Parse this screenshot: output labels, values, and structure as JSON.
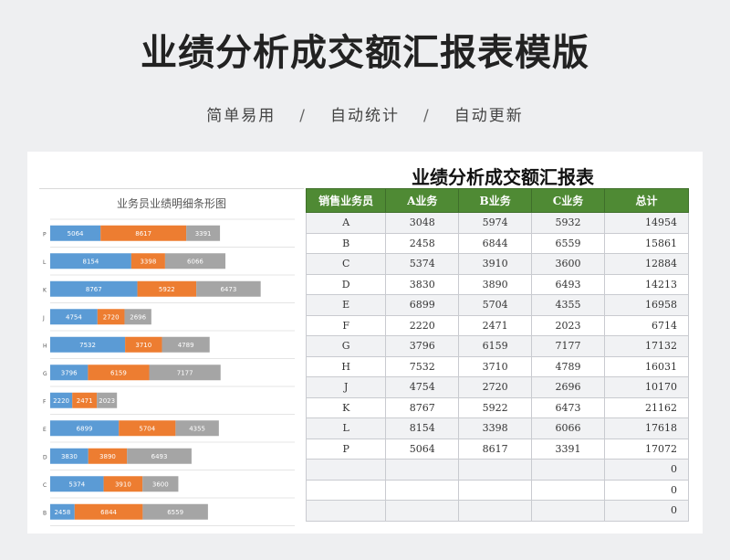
{
  "page": {
    "title": "业绩分析成交额汇报表模版",
    "tagline": [
      "简单易用",
      "自动统计",
      "自动更新"
    ],
    "separator": "/"
  },
  "sheet": {
    "title": "业绩分析成交额汇报表"
  },
  "chart_data": {
    "type": "bar",
    "orientation": "horizontal-stacked",
    "title": "业务员业绩明细条形图",
    "categories": [
      "P",
      "L",
      "K",
      "J",
      "H",
      "G",
      "F",
      "E",
      "D",
      "C",
      "B"
    ],
    "series": [
      {
        "name": "A业务",
        "color": "#5b9bd5",
        "values": [
          5064,
          8154,
          8767,
          4754,
          7532,
          3796,
          2220,
          6899,
          3830,
          5374,
          2458
        ]
      },
      {
        "name": "B业务",
        "color": "#ed7d31",
        "values": [
          8617,
          3398,
          5922,
          2720,
          3710,
          6159,
          2471,
          5704,
          3890,
          3910,
          6844
        ]
      },
      {
        "name": "C业务",
        "color": "#a5a5a5",
        "values": [
          3391,
          6066,
          6473,
          2696,
          4789,
          7177,
          2023,
          4355,
          6493,
          3600,
          6559
        ]
      }
    ]
  },
  "table": {
    "headers": [
      "销售业务员",
      "A业务",
      "B业务",
      "C业务",
      "总计"
    ],
    "rows": [
      [
        "A",
        "3048",
        "5974",
        "5932",
        "14954"
      ],
      [
        "B",
        "2458",
        "6844",
        "6559",
        "15861"
      ],
      [
        "C",
        "5374",
        "3910",
        "3600",
        "12884"
      ],
      [
        "D",
        "3830",
        "3890",
        "6493",
        "14213"
      ],
      [
        "E",
        "6899",
        "5704",
        "4355",
        "16958"
      ],
      [
        "F",
        "2220",
        "2471",
        "2023",
        "6714"
      ],
      [
        "G",
        "3796",
        "6159",
        "7177",
        "17132"
      ],
      [
        "H",
        "7532",
        "3710",
        "4789",
        "16031"
      ],
      [
        "J",
        "4754",
        "2720",
        "2696",
        "10170"
      ],
      [
        "K",
        "8767",
        "5922",
        "6473",
        "21162"
      ],
      [
        "L",
        "8154",
        "3398",
        "6066",
        "17618"
      ],
      [
        "P",
        "5064",
        "8617",
        "3391",
        "17072"
      ],
      [
        "",
        "",
        "",
        "",
        "0"
      ],
      [
        "",
        "",
        "",
        "",
        "0"
      ],
      [
        "",
        "",
        "",
        "",
        "0"
      ]
    ]
  }
}
